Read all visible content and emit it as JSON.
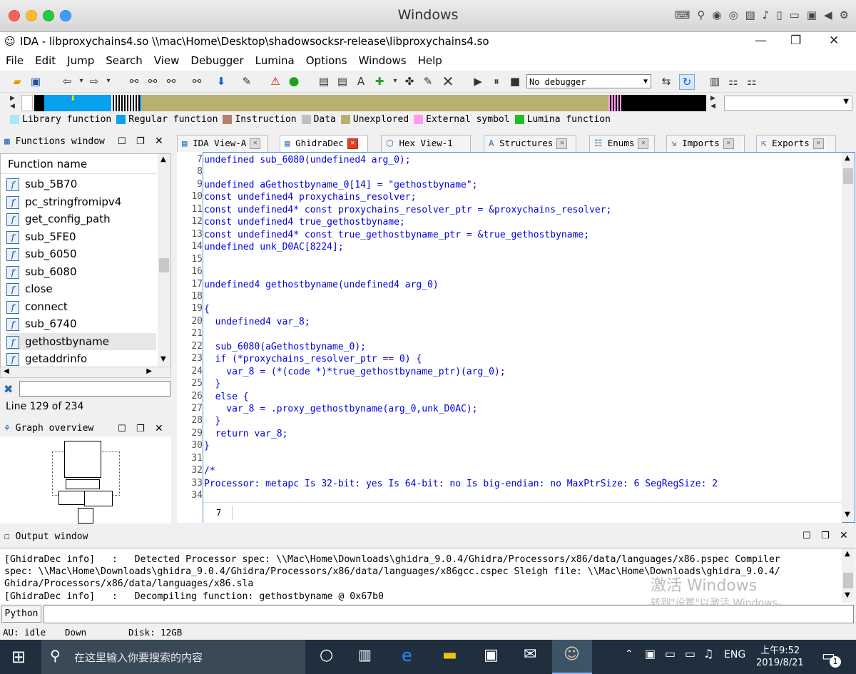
{
  "mac": {
    "title": "Windows"
  },
  "ida": {
    "title": "IDA - libproxychains4.so \\\\mac\\Home\\Desktop\\shadowsocksr-release\\libproxychains4.so",
    "menu": [
      "File",
      "Edit",
      "Jump",
      "Search",
      "View",
      "Debugger",
      "Lumina",
      "Options",
      "Windows",
      "Help"
    ],
    "debugger_select": "No debugger"
  },
  "legend": [
    {
      "label": "Library function",
      "color": "#a8e8ff"
    },
    {
      "label": "Regular function",
      "color": "#0aa0f0"
    },
    {
      "label": "Instruction",
      "color": "#b8806a"
    },
    {
      "label": "Data",
      "color": "#c0c0c0"
    },
    {
      "label": "Unexplored",
      "color": "#b8b070"
    },
    {
      "label": "External symbol",
      "color": "#ff9cf0"
    },
    {
      "label": "Lumina function",
      "color": "#20c020"
    }
  ],
  "functions": {
    "panel_title": "Functions window",
    "column": "Function name",
    "items": [
      "sub_5B70",
      "pc_stringfromipv4",
      "get_config_path",
      "sub_5FE0",
      "sub_6050",
      "sub_6080",
      "close",
      "connect",
      "sub_6740",
      "gethostbyname",
      "getaddrinfo"
    ],
    "selected": "gethostbyname",
    "status": "Line 129 of 234"
  },
  "graph": {
    "panel_title": "Graph overview"
  },
  "tabs": [
    "IDA View-A",
    "GhidraDec",
    "Hex View-1",
    "Structures",
    "Enums",
    "Imports",
    "Exports"
  ],
  "code": {
    "lines": [
      {
        "n": "7",
        "t": "undefined sub_6080(undefined4 arg_0);"
      },
      {
        "n": "8",
        "t": ""
      },
      {
        "n": "9",
        "t": "undefined aGethostbyname_0[14] = \"gethostbyname\";"
      },
      {
        "n": "10",
        "t": "const undefined4 proxychains_resolver;"
      },
      {
        "n": "11",
        "t": "const undefined4* const proxychains_resolver_ptr = &proxychains_resolver;"
      },
      {
        "n": "12",
        "t": "const undefined4 true_gethostbyname;"
      },
      {
        "n": "13",
        "t": "const undefined4* const true_gethostbyname_ptr = &true_gethostbyname;"
      },
      {
        "n": "14",
        "t": "undefined unk_D0AC[8224];"
      },
      {
        "n": "15",
        "t": ""
      },
      {
        "n": "16",
        "t": ""
      },
      {
        "n": "17",
        "t": "undefined4 gethostbyname(undefined4 arg_0)"
      },
      {
        "n": "18",
        "t": ""
      },
      {
        "n": "19",
        "t": "{"
      },
      {
        "n": "20",
        "t": "  undefined4 var_8;"
      },
      {
        "n": "21",
        "t": ""
      },
      {
        "n": "22",
        "t": "  sub_6080(aGethostbyname_0);"
      },
      {
        "n": "23",
        "t": "  if (*proxychains_resolver_ptr == 0) {"
      },
      {
        "n": "24",
        "t": "    var_8 = (*(code *)*true_gethostbyname_ptr)(arg_0);"
      },
      {
        "n": "25",
        "t": "  }"
      },
      {
        "n": "26",
        "t": "  else {"
      },
      {
        "n": "27",
        "t": "    var_8 = .proxy_gethostbyname(arg_0,unk_D0AC);"
      },
      {
        "n": "28",
        "t": "  }"
      },
      {
        "n": "29",
        "t": "  return var_8;"
      },
      {
        "n": "30",
        "t": "}"
      },
      {
        "n": "31",
        "t": ""
      },
      {
        "n": "32",
        "t": "/*"
      },
      {
        "n": "33",
        "t": "Processor: metapc Is 32-bit: yes Is 64-bit: no Is big-endian: no MaxPtrSize: 6 SegRegSize: 2"
      },
      {
        "n": "34",
        "t": ""
      }
    ],
    "footer_line": "7"
  },
  "output": {
    "panel_title": "Output window",
    "lines": [
      "[GhidraDec info]   :   Detected Processor spec: \\\\Mac\\Home\\Downloads\\ghidra_9.0.4/Ghidra/Processors/x86/data/languages/x86.pspec Compiler",
      "spec: \\\\Mac\\Home\\Downloads\\ghidra_9.0.4/Ghidra/Processors/x86/data/languages/x86gcc.cspec Sleigh file: \\\\Mac\\Home\\Downloads\\ghidra_9.0.4/",
      "Ghidra/Processors/x86/data/languages/x86.sla",
      "[GhidraDec info]   :   Decompiling function: gethostbyname @ 0x67b0"
    ],
    "python_label": "Python",
    "watermark1": "激活 Windows",
    "watermark2": "转到\"设置\"以激活 Windows。"
  },
  "status": {
    "au": "AU:  idle",
    "dir": "Down",
    "disk": "Disk: 12GB"
  },
  "taskbar": {
    "search": "在这里输入你要搜索的内容",
    "lang": "ENG",
    "time": "上午9:52",
    "date": "2019/8/21",
    "notif": "1"
  }
}
